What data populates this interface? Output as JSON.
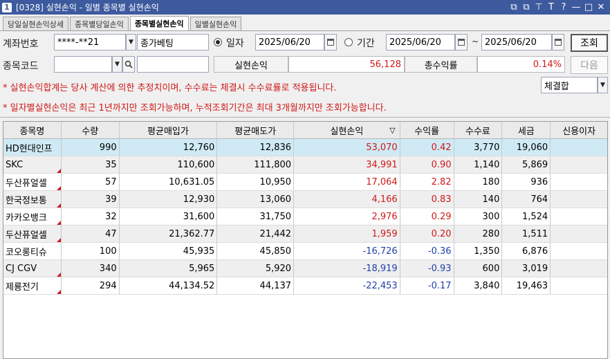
{
  "window": {
    "badge": "1",
    "title": "[0328] 실현손익 - 일별 종목별 실현손익",
    "controls": [
      "⧉",
      "⧉",
      "⊤",
      "T",
      "?",
      "—",
      "□",
      "✕"
    ]
  },
  "tabs": [
    {
      "label": "당일실현손익상세",
      "active": false
    },
    {
      "label": "종목별당일손익",
      "active": false
    },
    {
      "label": "종목별실현손익",
      "active": true
    },
    {
      "label": "일별실현손익",
      "active": false
    }
  ],
  "form": {
    "account_label": "계좌번호",
    "account_value": "****-**21",
    "account_name": "종가베팅",
    "radio_day_label": "일자",
    "day_date": "2025/06/20",
    "radio_period_label": "기간",
    "period_from": "2025/06/20",
    "tilde": "~",
    "period_to": "2025/06/20",
    "query_button": "조회",
    "stock_code_label": "종목코드",
    "stock_code_value": "",
    "stock_name_value": "",
    "realized_label": "실현손익",
    "realized_value": "56,128",
    "return_label": "총수익률",
    "return_value": "0.14%",
    "next_button": "다음",
    "filter_select": "체결합"
  },
  "notices": [
    "* 실현손익합계는 당사 계산에 의한 추정치이며, 수수료는 체결시 수수료률로 적용됩니다.",
    "* 일자별실현손익은 최근 1년까지만 조회가능하며, 누적조회기간은 최대 3개월까지만 조회가능합니다."
  ],
  "table": {
    "sort_indicator": "▽",
    "columns": [
      "종목명",
      "수량",
      "평균매입가",
      "평균매도가",
      "실현손익",
      "수익률",
      "수수료",
      "세금",
      "신용이자"
    ],
    "rows": [
      {
        "name": "HD현대인프",
        "qty": "990",
        "buy": "12,760",
        "sell": "12,836",
        "pnl": "53,070",
        "rate": "0.42",
        "fee": "3,770",
        "tax": "19,060",
        "interest": "",
        "sign": "pos",
        "flag": false
      },
      {
        "name": "SKC",
        "qty": "35",
        "buy": "110,600",
        "sell": "111,800",
        "pnl": "34,991",
        "rate": "0.90",
        "fee": "1,140",
        "tax": "5,869",
        "interest": "",
        "sign": "pos",
        "flag": true
      },
      {
        "name": "두산퓨얼셀",
        "qty": "57",
        "buy": "10,631.05",
        "sell": "10,950",
        "pnl": "17,064",
        "rate": "2.82",
        "fee": "180",
        "tax": "936",
        "interest": "",
        "sign": "pos",
        "flag": true
      },
      {
        "name": "한국정보통",
        "qty": "39",
        "buy": "12,930",
        "sell": "13,060",
        "pnl": "4,166",
        "rate": "0.83",
        "fee": "140",
        "tax": "764",
        "interest": "",
        "sign": "pos",
        "flag": true
      },
      {
        "name": "카카오뱅크",
        "qty": "32",
        "buy": "31,600",
        "sell": "31,750",
        "pnl": "2,976",
        "rate": "0.29",
        "fee": "300",
        "tax": "1,524",
        "interest": "",
        "sign": "pos",
        "flag": true
      },
      {
        "name": "두산퓨얼셀",
        "qty": "47",
        "buy": "21,362.77",
        "sell": "21,442",
        "pnl": "1,959",
        "rate": "0.20",
        "fee": "280",
        "tax": "1,511",
        "interest": "",
        "sign": "pos",
        "flag": true
      },
      {
        "name": "코오롱티슈",
        "qty": "100",
        "buy": "45,935",
        "sell": "45,850",
        "pnl": "-16,726",
        "rate": "-0.36",
        "fee": "1,350",
        "tax": "6,876",
        "interest": "",
        "sign": "neg",
        "flag": false
      },
      {
        "name": "CJ CGV",
        "qty": "340",
        "buy": "5,965",
        "sell": "5,920",
        "pnl": "-18,919",
        "rate": "-0.93",
        "fee": "600",
        "tax": "3,019",
        "interest": "",
        "sign": "neg",
        "flag": true
      },
      {
        "name": "제룡전기",
        "qty": "294",
        "buy": "44,134.52",
        "sell": "44,137",
        "pnl": "-22,453",
        "rate": "-0.17",
        "fee": "3,840",
        "tax": "19,463",
        "interest": "",
        "sign": "neg",
        "flag": true
      }
    ]
  },
  "colors": {
    "titlebar": "#3d5a9e",
    "positive": "#d01818",
    "negative": "#1f3fa8",
    "selected_row": "#cfeaf4"
  }
}
